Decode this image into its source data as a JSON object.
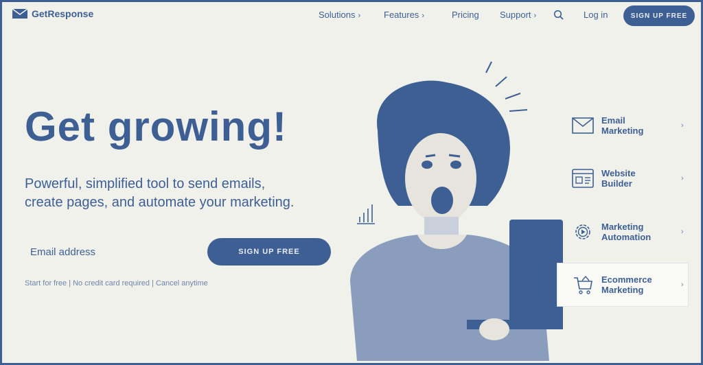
{
  "header": {
    "logo_text": "GetResponse",
    "nav": [
      {
        "label": "Solutions",
        "chevron": "›"
      },
      {
        "label": "Features",
        "chevron": "›"
      },
      {
        "label": "Pricing",
        "chevron": ""
      },
      {
        "label": "Support",
        "chevron": "›"
      }
    ],
    "login": "Log in",
    "signup": "SIGN UP FREE"
  },
  "hero": {
    "headline": "Get growing!",
    "subline_1": "Powerful, simplified tool to send emails,",
    "subline_2": "create pages, and automate your marketing.",
    "email_placeholder": "Email address",
    "cta": "SIGN UP FREE",
    "fine_print": "Start for free | No credit card required | Cancel anytime"
  },
  "features": [
    {
      "line1": "Email",
      "line2": "Marketing",
      "icon": "envelope-icon"
    },
    {
      "line1": "Website",
      "line2": "Builder",
      "icon": "website-builder-icon"
    },
    {
      "line1": "Marketing",
      "line2": "Automation",
      "icon": "gear-play-icon"
    },
    {
      "line1": "Ecommerce",
      "line2": "Marketing",
      "icon": "shopping-cart-icon"
    }
  ],
  "colors": {
    "brand": "#3d5f93",
    "background": "#f1f1ec"
  }
}
